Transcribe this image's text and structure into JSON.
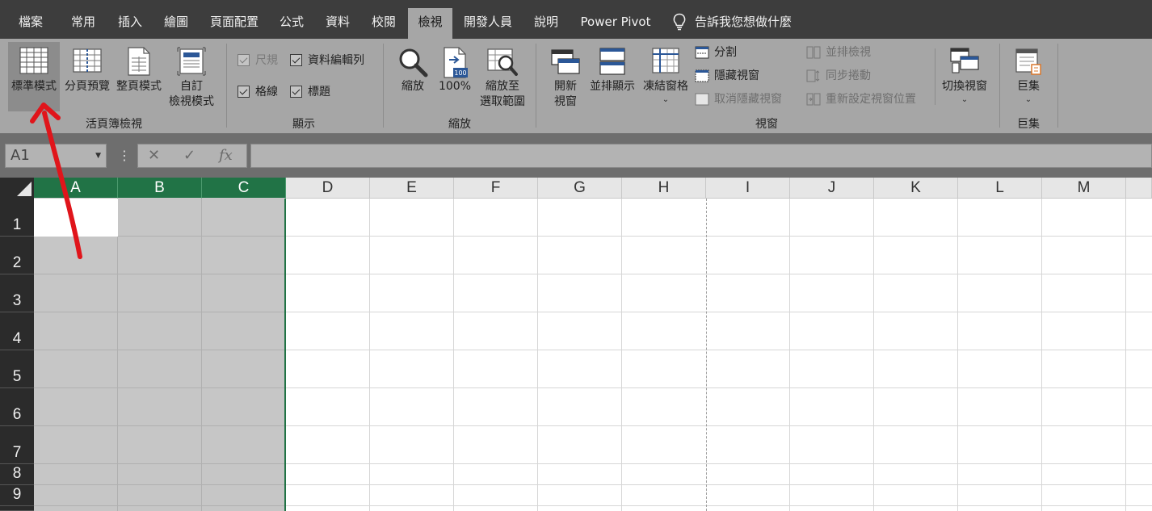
{
  "tabs": [
    {
      "label": "檔案",
      "active": false
    },
    {
      "label": "常用",
      "active": false
    },
    {
      "label": "插入",
      "active": false
    },
    {
      "label": "繪圖",
      "active": false
    },
    {
      "label": "頁面配置",
      "active": false
    },
    {
      "label": "公式",
      "active": false
    },
    {
      "label": "資料",
      "active": false
    },
    {
      "label": "校閱",
      "active": false
    },
    {
      "label": "檢視",
      "active": true
    },
    {
      "label": "開發人員",
      "active": false
    },
    {
      "label": "說明",
      "active": false
    },
    {
      "label": "Power Pivot",
      "active": false
    }
  ],
  "tell_me": "告訴我您想做什麼",
  "ribbon": {
    "workbook_views": {
      "group_label": "活頁簿檢視",
      "normal": "標準模式",
      "page_break": "分頁預覽",
      "page_layout": "整頁模式",
      "custom": "自訂\n檢視模式"
    },
    "show": {
      "group_label": "顯示",
      "ruler": "尺規",
      "formula_bar": "資料編輯列",
      "gridlines": "格線",
      "headings": "標題"
    },
    "zoom": {
      "group_label": "縮放",
      "zoom": "縮放",
      "zoom_100": "100%",
      "zoom_100_icon_text": "100",
      "zoom_selection": "縮放至\n選取範圍"
    },
    "window": {
      "group_label": "視窗",
      "new_window": "開新\n視窗",
      "arrange_all": "並排顯示",
      "freeze_panes": "凍結窗格",
      "split": "分割",
      "hide": "隱藏視窗",
      "unhide": "取消隱藏視窗",
      "side_by_side": "並排檢視",
      "sync_scroll": "同步捲動",
      "reset_position": "重新設定視窗位置",
      "switch_windows": "切換視窗"
    },
    "macros": {
      "group_label": "巨集",
      "macros": "巨集"
    }
  },
  "formula_bar": {
    "name_box": "A1",
    "cancel_glyph": "✕",
    "enter_glyph": "✓",
    "fx_glyph": "fx",
    "formula": ""
  },
  "columns": [
    "A",
    "B",
    "C",
    "D",
    "E",
    "F",
    "G",
    "H",
    "I",
    "J",
    "K",
    "L",
    "M"
  ],
  "selected_columns": [
    "A",
    "B",
    "C"
  ],
  "rows": [
    "1",
    "2",
    "3",
    "4",
    "5",
    "6",
    "7",
    "8",
    "9"
  ],
  "colors": {
    "selection_green": "#217346",
    "annotation_arrow": "#e0151b"
  }
}
